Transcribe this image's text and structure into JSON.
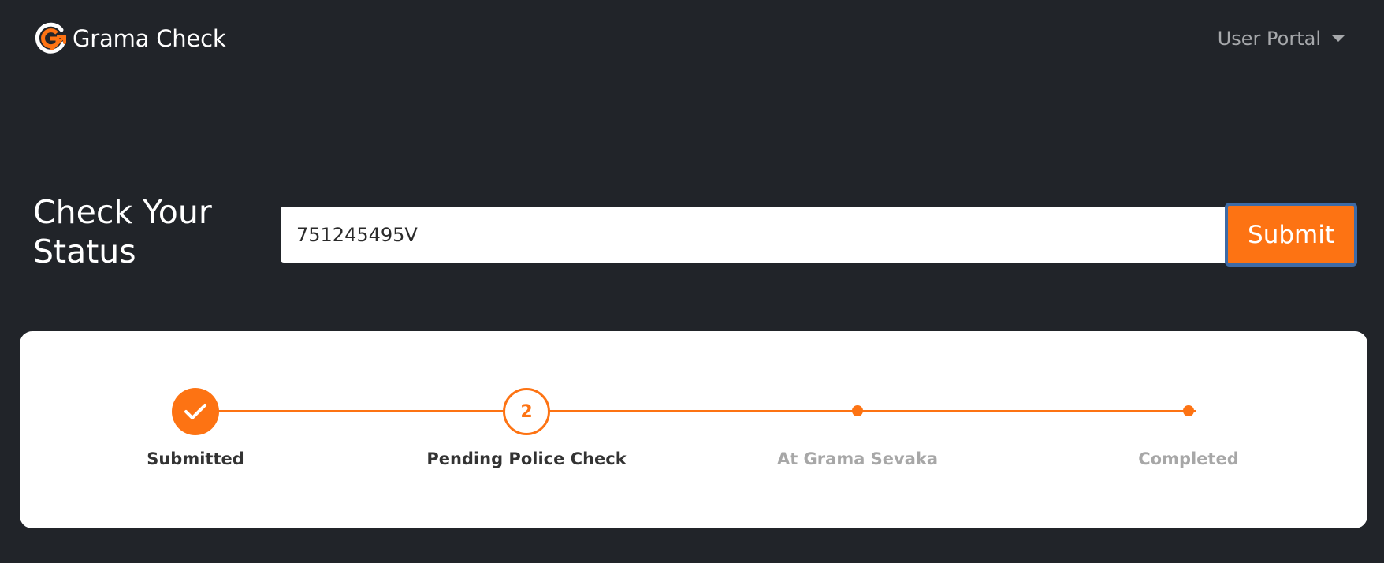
{
  "navbar": {
    "brand_name": "Grama Check",
    "brand_logo": "grama-check-g-logo",
    "portal_menu_label": "User Portal",
    "portal_menu_icon": "caret-down-icon"
  },
  "status_form": {
    "title": "Check Your Status",
    "input_value": "751245495V",
    "submit_label": "Submit"
  },
  "progress": {
    "current_step": 2,
    "steps": [
      {
        "label": "Submitted",
        "state": "completed",
        "icon": "check-icon"
      },
      {
        "label": "Pending Police Check",
        "state": "current",
        "number": "2"
      },
      {
        "label": "At Grama Sevaka",
        "state": "upcoming"
      },
      {
        "label": "Completed",
        "state": "upcoming"
      }
    ]
  },
  "colors": {
    "background": "#212429",
    "accent": "#fd7313",
    "card": "#ffffff",
    "muted_text": "#a7a7a7",
    "button_focus_border": "#3e6ba6"
  }
}
